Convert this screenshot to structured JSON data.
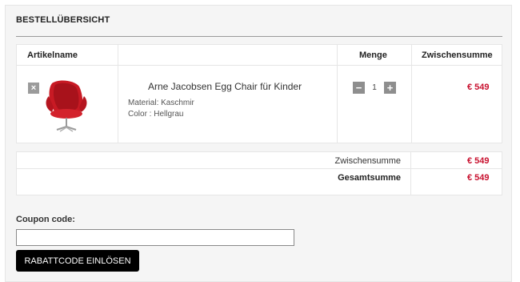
{
  "title": "BESTELLÜBERSICHT",
  "cart": {
    "headers": {
      "article": "Artikelname",
      "quantity": "Menge",
      "subtotal": "Zwischensumme"
    },
    "item": {
      "remove_glyph": "×",
      "name": "Arne Jacobsen Egg Chair für Kinder",
      "attr1": "Material: Kaschmir",
      "attr2": "Color : Hellgrau",
      "qty_minus": "−",
      "quantity": "1",
      "qty_plus": "+",
      "price": "€ 549",
      "image_icon": "red-egg-chair"
    }
  },
  "totals": {
    "subtotal_label": "Zwischensumme",
    "subtotal_value": "€ 549",
    "total_label": "Gesamtsumme",
    "total_value": "€ 549"
  },
  "coupon": {
    "label": "Coupon code:",
    "placeholder": "",
    "button": "RABATTCODE EINLÖSEN"
  },
  "colors": {
    "price_red": "#c8102e",
    "button_black": "#000000",
    "panel_bg": "#f5f5f5"
  }
}
